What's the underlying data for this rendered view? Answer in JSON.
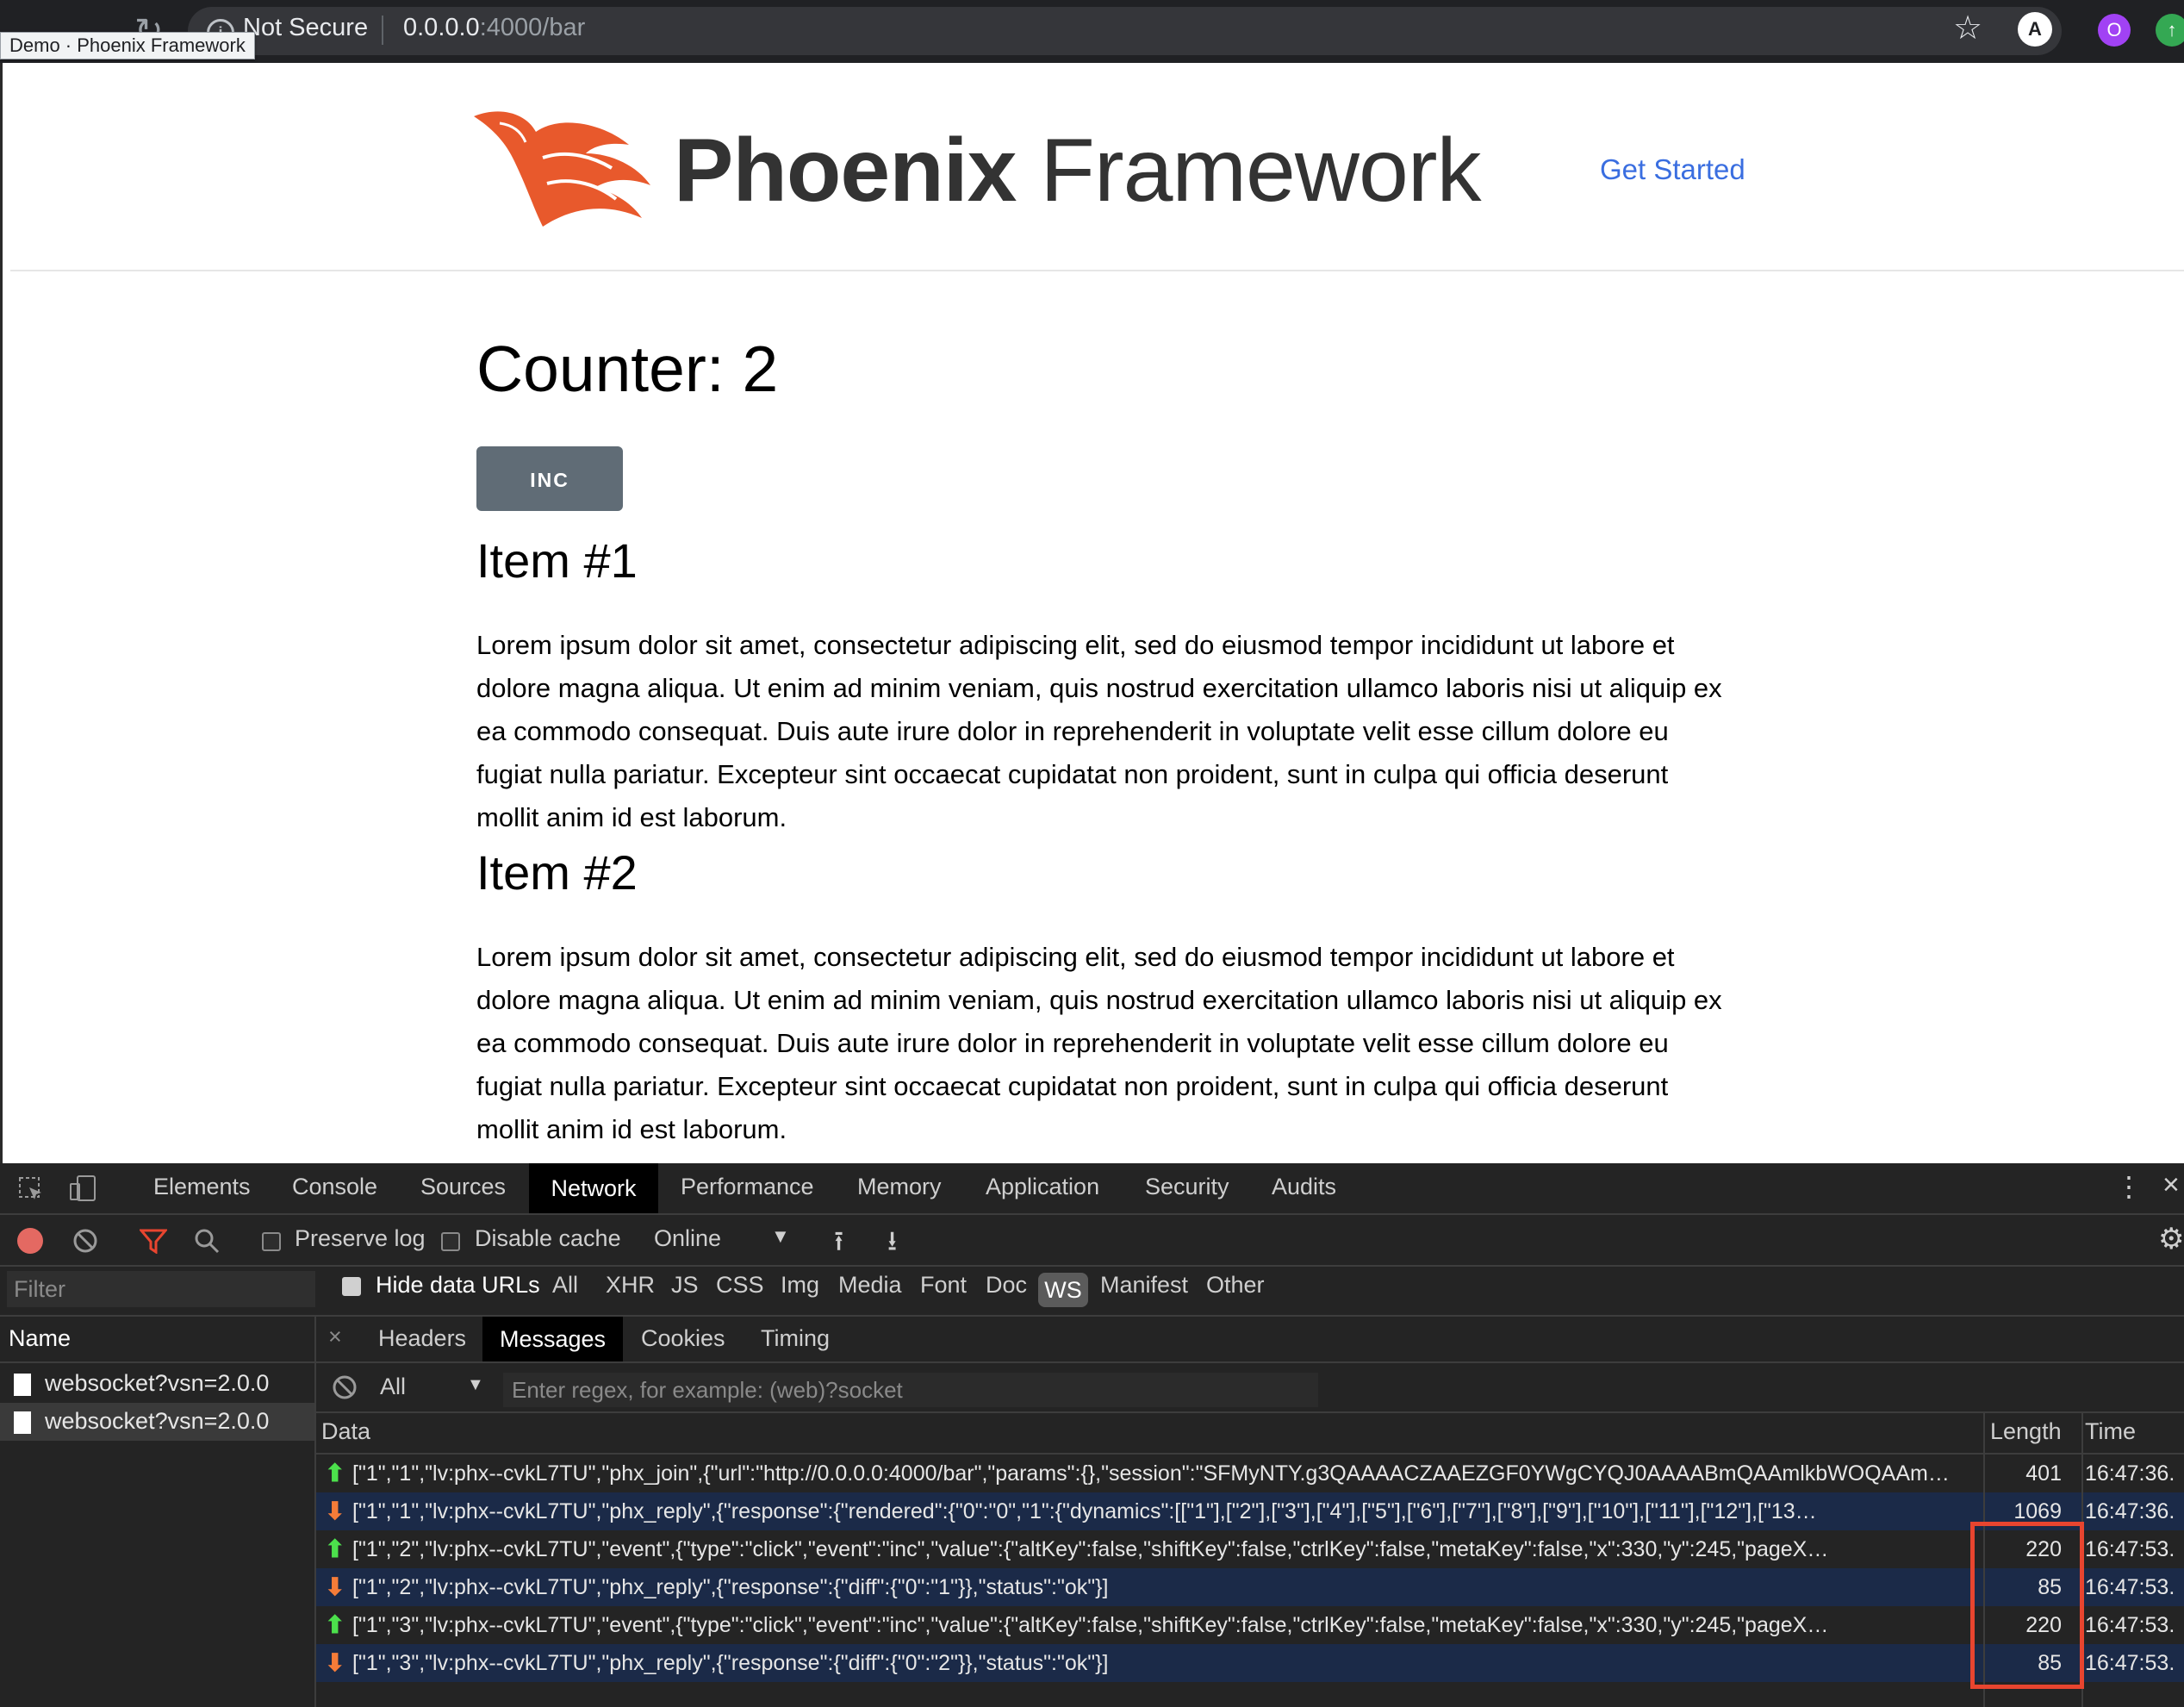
{
  "browser": {
    "security_label": "Not Secure",
    "url_host": "0.0.0.0",
    "url_path": ":4000/bar",
    "tooltip": "Demo · Phoenix Framework",
    "profile_initial": "O"
  },
  "site": {
    "logo_bold": "Phoenix",
    "logo_light": " Framework",
    "nav_link": "Get Started"
  },
  "main": {
    "counter": "Counter: 2",
    "inc_label": "INC",
    "items": [
      {
        "title": "Item #1",
        "body": "Lorem ipsum dolor sit amet, consectetur adipiscing elit, sed do eiusmod tempor incididunt ut labore et dolore magna aliqua. Ut enim ad minim veniam, quis nostrud exercitation ullamco laboris nisi ut aliquip ex ea commodo consequat. Duis aute irure dolor in reprehenderit in voluptate velit esse cillum dolore eu fugiat nulla pariatur. Excepteur sint occaecat cupidatat non proident, sunt in culpa qui officia deserunt mollit anim id est laborum."
      },
      {
        "title": "Item #2",
        "body": "Lorem ipsum dolor sit amet, consectetur adipiscing elit, sed do eiusmod tempor incididunt ut labore et dolore magna aliqua. Ut enim ad minim veniam, quis nostrud exercitation ullamco laboris nisi ut aliquip ex ea commodo consequat. Duis aute irure dolor in reprehenderit in voluptate velit esse cillum dolore eu fugiat nulla pariatur. Excepteur sint occaecat cupidatat non proident, sunt in culpa qui officia deserunt mollit anim id est laborum."
      }
    ]
  },
  "devtools": {
    "tabs": [
      "Elements",
      "Console",
      "Sources",
      "Network",
      "Performance",
      "Memory",
      "Application",
      "Security",
      "Audits"
    ],
    "toolbar": {
      "preserve_log": "Preserve log",
      "disable_cache": "Disable cache",
      "throttle": "Online"
    },
    "filter": {
      "placeholder": "Filter",
      "hide_data_urls": "Hide data URLs",
      "types": [
        "All",
        "XHR",
        "JS",
        "CSS",
        "Img",
        "Media",
        "Font",
        "Doc",
        "WS",
        "Manifest",
        "Other"
      ]
    },
    "requests_header": "Name",
    "requests": [
      "websocket?vsn=2.0.0",
      "websocket?vsn=2.0.0"
    ],
    "detail_tabs": [
      "Headers",
      "Messages",
      "Cookies",
      "Timing"
    ],
    "messages_filter": {
      "select_value": "All",
      "regex_placeholder": "Enter regex, for example: (web)?socket"
    },
    "columns": {
      "data": "Data",
      "length": "Length",
      "time": "Time"
    },
    "messages": [
      {
        "dir": "sent",
        "data": "[\"1\",\"1\",\"lv:phx--cvkL7TU\",\"phx_join\",{\"url\":\"http://0.0.0.0:4000/bar\",\"params\":{},\"session\":\"SFMyNTY.g3QAAAACZAAEZGF0YWgCYQJ0AAAABmQAAmlkbWOQAAmlkb…",
        "length": "401",
        "time": "16:47:36."
      },
      {
        "dir": "received",
        "data": "[\"1\",\"1\",\"lv:phx--cvkL7TU\",\"phx_reply\",{\"response\":{\"rendered\":{\"0\":\"0\",\"1\":{\"dynamics\":[[\"1\"],[\"2\"],[\"3\"],[\"4\"],[\"5\"],[\"6\"],[\"7\"],[\"8\"],[\"9\"],[\"10\"],[\"11\"],[\"12\"],[\"13…",
        "length": "1069",
        "time": "16:47:36."
      },
      {
        "dir": "sent",
        "data": "[\"1\",\"2\",\"lv:phx--cvkL7TU\",\"event\",{\"type\":\"click\",\"event\":\"inc\",\"value\":{\"altKey\":false,\"shiftKey\":false,\"ctrlKey\":false,\"metaKey\":false,\"x\":330,\"y\":245,\"pageX…",
        "length": "220",
        "time": "16:47:53."
      },
      {
        "dir": "received",
        "data": "[\"1\",\"2\",\"lv:phx--cvkL7TU\",\"phx_reply\",{\"response\":{\"diff\":{\"0\":\"1\"}},\"status\":\"ok\"}]",
        "length": "85",
        "time": "16:47:53."
      },
      {
        "dir": "sent",
        "data": "[\"1\",\"3\",\"lv:phx--cvkL7TU\",\"event\",{\"type\":\"click\",\"event\":\"inc\",\"value\":{\"altKey\":false,\"shiftKey\":false,\"ctrlKey\":false,\"metaKey\":false,\"x\":330,\"y\":245,\"pageX…",
        "length": "220",
        "time": "16:47:53."
      },
      {
        "dir": "received",
        "data": "[\"1\",\"3\",\"lv:phx--cvkL7TU\",\"phx_reply\",{\"response\":{\"diff\":{\"0\":\"2\"}},\"status\":\"ok\"}]",
        "length": "85",
        "time": "16:47:53."
      }
    ],
    "colors": {
      "sent_arrow": "#4ce04c",
      "received_arrow": "#f57c38",
      "highlight": "#e8452f",
      "record": "#e46962"
    }
  }
}
